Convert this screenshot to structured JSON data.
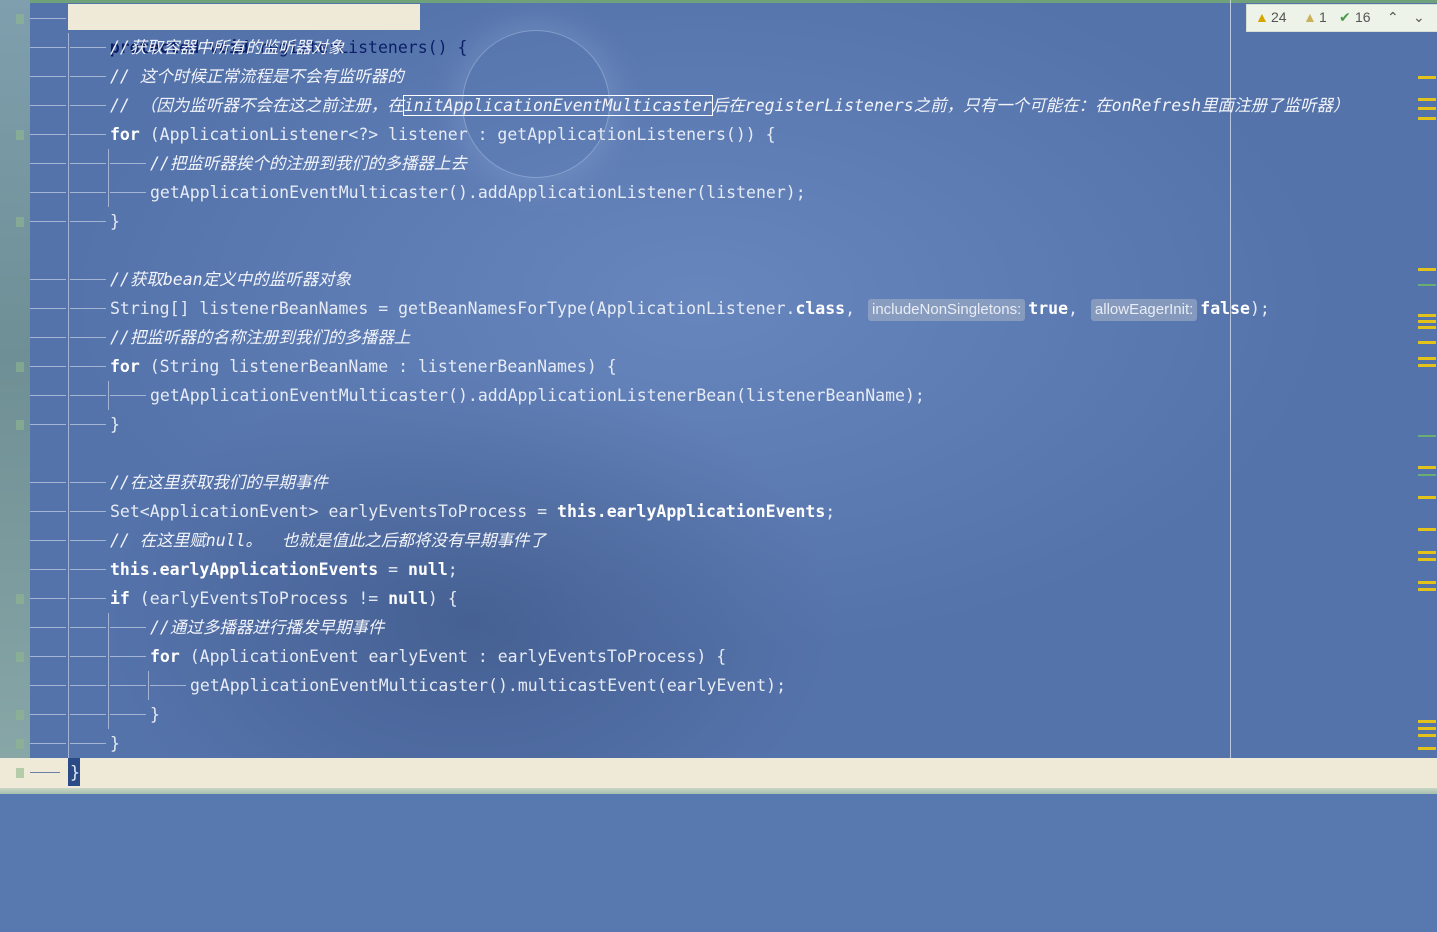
{
  "status": {
    "warnings": "24",
    "weak_warnings": "1",
    "typos": "16"
  },
  "code": {
    "l1_kw1": "protected",
    "l1_kw2": "void",
    "l1_fn": "registerListeners",
    "l1_rest": "() {",
    "l2": "//获取容器中所有的监听器对象",
    "l3": "// 这个时候正常流程是不会有监听器的",
    "l4_a": "// （因为监听器不会在这之前注册，在",
    "l4_b": "initApplicationEventMulticaster",
    "l4_c": "后在registerListeners之前，只有一个可能在：在onRefresh里面注册了监听器）",
    "l5_kw": "for",
    "l5_rest": " (ApplicationListener<?> listener : getApplicationListeners()) {",
    "l6": "//把监听器挨个的注册到我们的多播器上去",
    "l7": "getApplicationEventMulticaster().addApplicationListener(listener);",
    "l8": "}",
    "l10": "//获取bean定义中的监听器对象",
    "l11_a": "String[] listenerBeanNames = getBeanNamesForType(ApplicationListener.",
    "l11_kw": "class",
    "l11_b": ", ",
    "l11_hint1": "includeNonSingletons:",
    "l11_true": "true",
    "l11_c": ", ",
    "l11_hint2": "allowEagerInit:",
    "l11_false": "false",
    "l11_d": ");",
    "l12": "//把监听器的名称注册到我们的多播器上",
    "l13_kw": "for",
    "l13_rest": " (String listenerBeanName : listenerBeanNames) {",
    "l14": "getApplicationEventMulticaster().addApplicationListenerBean(listenerBeanName);",
    "l15": "}",
    "l17": "//在这里获取我们的早期事件",
    "l18_a": "Set<ApplicationEvent> earlyEventsToProcess = ",
    "l18_kw": "this",
    "l18_fld": ".earlyApplicationEvents",
    "l18_b": ";",
    "l19": "// 在这里赋null。  也就是值此之后都将没有早期事件了",
    "l20_kw": "this",
    "l20_fld": ".earlyApplicationEvents",
    "l20_b": " = ",
    "l20_null": "null",
    "l20_c": ";",
    "l21_kw": "if",
    "l21_a": " (earlyEventsToProcess != ",
    "l21_null": "null",
    "l21_b": ") {",
    "l22": "//通过多播器进行播发早期事件",
    "l23_kw": "for",
    "l23_rest": " (ApplicationEvent earlyEvent : earlyEventsToProcess) {",
    "l24": "getApplicationEventMulticaster().multicastEvent(earlyEvent);",
    "l25": "}",
    "l26": "}",
    "l27": "}"
  },
  "colors": {
    "editor_bg": "#5878b0",
    "keyword": "#ffffff",
    "warning": "#d8a400",
    "current_line": "#eeead7"
  }
}
